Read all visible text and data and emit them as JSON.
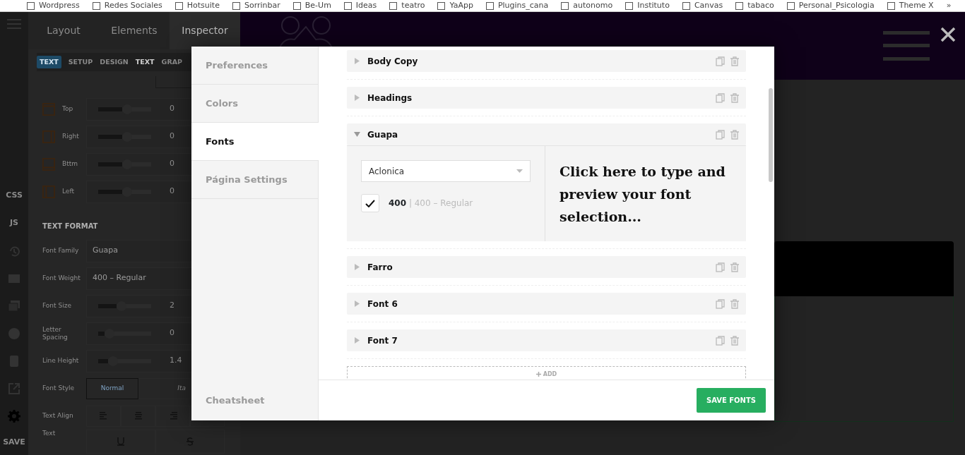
{
  "bookmarks": {
    "items": [
      "Wordpress",
      "Redes Sociales",
      "Hotsuite",
      "Sorrinbar",
      "Be-Um",
      "Ideas",
      "teatro",
      "YaApp",
      "Plugins_cana",
      "autonomo",
      "Instituto",
      "Canvas",
      "tabaco",
      "Personal_Psicologia",
      "Theme X"
    ],
    "overflow": "»"
  },
  "editor": {
    "tabs": [
      {
        "label": "Layout",
        "selected": false
      },
      {
        "label": "Elements",
        "selected": false
      },
      {
        "label": "Inspector",
        "selected": true
      }
    ],
    "breadcrumb": "TEXT",
    "subtabs": [
      {
        "label": "SETUP",
        "selected": false
      },
      {
        "label": "DESIGN",
        "selected": false
      },
      {
        "label": "TEXT",
        "selected": true
      },
      {
        "label": "GRAP",
        "selected": false
      }
    ],
    "spacing_rows": [
      {
        "label": "Top",
        "kind": "top",
        "level": 0.45,
        "value": "0"
      },
      {
        "label": "Right",
        "kind": "right",
        "level": 0.45,
        "value": "0"
      },
      {
        "label": "Bttm",
        "kind": "bottom",
        "level": 0.45,
        "value": "0"
      },
      {
        "label": "Left",
        "kind": "left",
        "level": 0.45,
        "value": "0"
      }
    ],
    "section_title": "TEXT FORMAT",
    "fields": [
      {
        "kind": "text",
        "label": "Font Family",
        "value": "Guapa"
      },
      {
        "kind": "text",
        "label": "Font Weight",
        "value": "400 – Regular"
      },
      {
        "kind": "slider",
        "label": "Font Size",
        "level": 0.35,
        "value": "2"
      },
      {
        "kind": "slider",
        "label": "Letter Spacing",
        "level": 0.12,
        "value": "0"
      },
      {
        "kind": "slider",
        "label": "Line Height",
        "level": 0.18,
        "value": "1.4"
      },
      {
        "kind": "toggle",
        "label": "Font Style",
        "options": [
          {
            "label": "Normal",
            "selected": true
          },
          {
            "label": "Ita",
            "selected": false
          }
        ]
      },
      {
        "kind": "align",
        "label": "Text Align"
      },
      {
        "kind": "decoration",
        "label": "Text"
      }
    ],
    "rail": {
      "labels": [
        "CSS",
        "JS"
      ],
      "save": "SAVE"
    }
  },
  "modal": {
    "nav": [
      {
        "label": "Preferences",
        "selected": false
      },
      {
        "label": "Colors",
        "selected": false
      },
      {
        "label": "Fonts",
        "selected": true
      },
      {
        "label": "Página Settings",
        "selected": false
      }
    ],
    "nav_footer": "Cheatsheet",
    "fonts": [
      {
        "name": "Body Copy",
        "expanded": false
      },
      {
        "name": "Headings",
        "expanded": false
      },
      {
        "name": "Guapa",
        "expanded": true,
        "family": "Aclonica",
        "weights": [
          {
            "value": "400",
            "separator": "|",
            "label": "400 – Regular",
            "checked": true
          }
        ],
        "preview": "Click here to type and preview your font selection..."
      },
      {
        "name": "Farro",
        "expanded": false
      },
      {
        "name": "Font 6",
        "expanded": false
      },
      {
        "name": "Font 7",
        "expanded": false
      }
    ],
    "add_label": "ADD",
    "save_button": "SAVE FONTS"
  }
}
